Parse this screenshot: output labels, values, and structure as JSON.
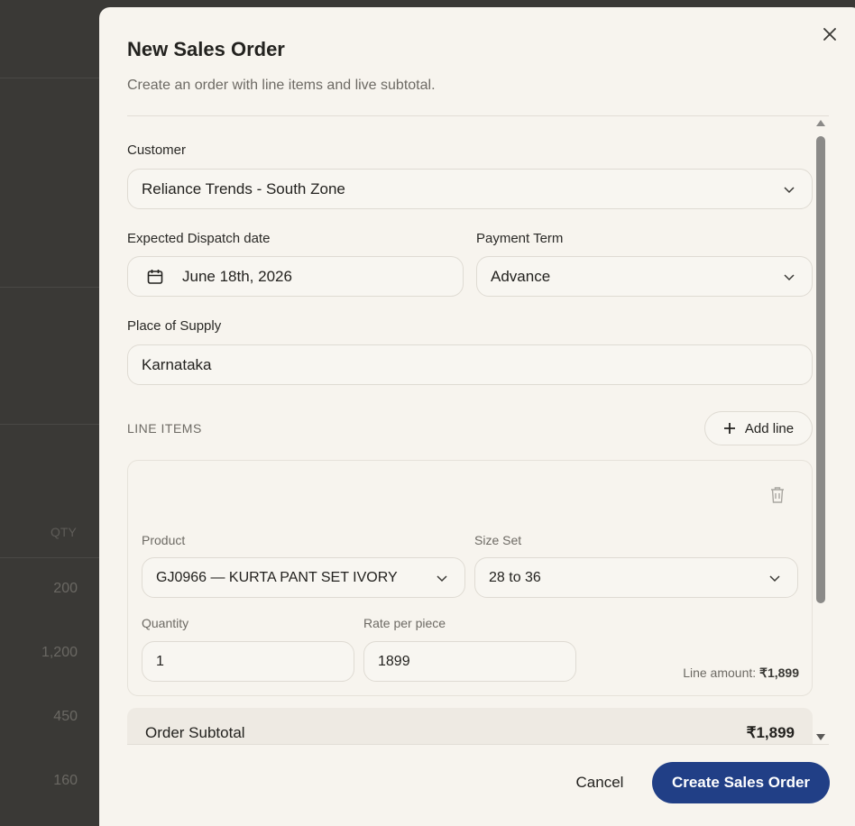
{
  "background": {
    "col_header": "QTY",
    "qty_values": [
      "200",
      "1,200",
      "450",
      "160"
    ]
  },
  "modal": {
    "title": "New Sales Order",
    "subtitle": "Create an order with line items and live subtotal."
  },
  "form": {
    "customer": {
      "label": "Customer",
      "value": "Reliance Trends - South Zone"
    },
    "dispatch_date": {
      "label": "Expected Dispatch date",
      "value": "June 18th, 2026"
    },
    "payment_term": {
      "label": "Payment Term",
      "value": "Advance"
    },
    "place_of_supply": {
      "label": "Place of Supply",
      "value": "Karnataka"
    }
  },
  "line_items": {
    "section_label": "LINE ITEMS",
    "add_label": "Add line",
    "items": [
      {
        "product_label": "Product",
        "product_value": "GJ0966 — KURTA PANT SET IVORY",
        "size_label": "Size Set",
        "size_value": "28 to 36",
        "quantity_label": "Quantity",
        "quantity_value": "1",
        "rate_label": "Rate per piece",
        "rate_value": "1899",
        "amount_label": "Line amount:",
        "amount_value": "₹1,899"
      }
    ]
  },
  "subtotal": {
    "label": "Order Subtotal",
    "value": "₹1,899"
  },
  "footer": {
    "cancel_label": "Cancel",
    "submit_label": "Create Sales Order"
  },
  "colors": {
    "primary": "#213f86",
    "modal_bg": "#f7f4ee",
    "overlay": "#2f2e2c"
  },
  "icons": [
    "close-icon",
    "calendar-icon",
    "chevron-down-icon",
    "plus-icon",
    "trash-icon"
  ]
}
